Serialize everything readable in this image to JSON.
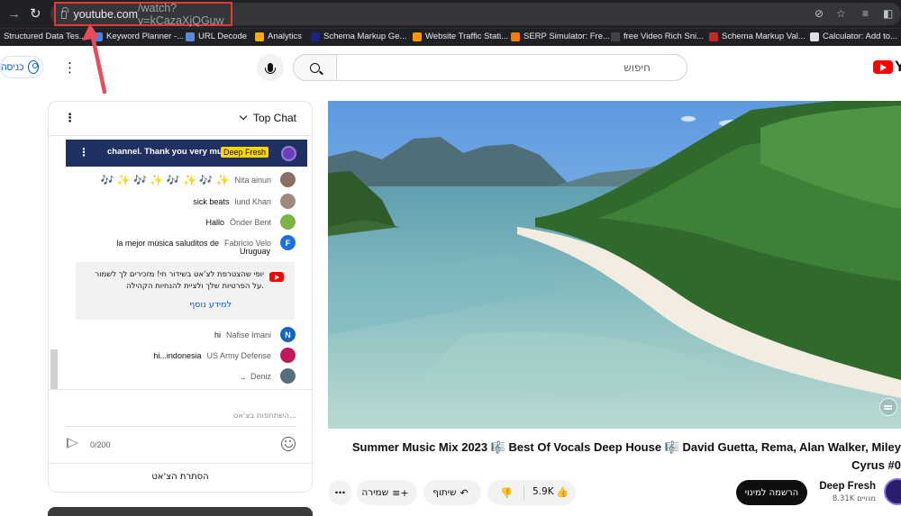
{
  "browser": {
    "url_host": "youtube.com",
    "url_path": "/watch?v=kCazaXjQGuw",
    "bookmarks": [
      {
        "label": "Structured Data Tes...",
        "color": "#9e9e9e"
      },
      {
        "label": "Keyword Planner -...",
        "color": "#4285f4"
      },
      {
        "label": "URL Decode",
        "color": "#5b8bd8"
      },
      {
        "label": "Analytics",
        "color": "#f9ab00"
      },
      {
        "label": "Schema Markup Ge...",
        "color": "#1a237e"
      },
      {
        "label": "Website Traffic Stati...",
        "color": "#ff9800"
      },
      {
        "label": "SERP Simulator: Fre...",
        "color": "#f57c00"
      },
      {
        "label": "free Video Rich Sni...",
        "color": "#424242"
      },
      {
        "label": "Schema Markup Val...",
        "color": "#c62828"
      },
      {
        "label": "Calculator: Add to...",
        "color": "#e0e0e0"
      }
    ]
  },
  "header": {
    "signin_label": "כניסה",
    "search_placeholder": "חיפוש",
    "logo_text": "Y"
  },
  "chat": {
    "title": "Top Chat",
    "pinned": {
      "text": "channel. Thank you very much...",
      "badge": "Deep Fresh"
    },
    "messages": [
      {
        "text": "🎶 ✨ 🎶 ✨ 🎶 ✨ 🎶 ✨",
        "author": "Nita ainun",
        "avatar_color": "#8d6e63",
        "initial": ""
      },
      {
        "text": "sick beats",
        "author": "lund Khan",
        "avatar_color": "#a1887f",
        "initial": ""
      },
      {
        "text": "Hallo",
        "author": "Önder Bent",
        "avatar_color": "#7cb342",
        "initial": ""
      },
      {
        "text": "la mejor música saluditos de",
        "author": "Fabricio Velo",
        "author2": "Uruguay",
        "avatar_color": "#1e6fd9",
        "initial": "F"
      },
      {
        "text": "hi",
        "author": "Nafise Imani",
        "avatar_color": "#1565c0",
        "initial": "N"
      },
      {
        "text": "hi...indonesia",
        "author": "US Army Defense",
        "avatar_color": "#c2185b",
        "initial": ""
      },
      {
        "text": "..",
        "author": "Deniz",
        "avatar_color": "#546e7a",
        "initial": ""
      }
    ],
    "notice_text": "יופי שהצטרפת לצ'אט בשידור חי! מזכירים לך לשמור על הפרטיות שלך ולציית להנחיות הקהילה.",
    "notice_link": "למידע נוסף",
    "compose_placeholder": "השתתפות בצ'אט...",
    "counter": "0/200",
    "hide_label": "הסתרת הצ'אט"
  },
  "video": {
    "title": "Summer Music Mix 2023 🎼 Best Of Vocals Deep House 🎼 David Guetta, Rema, Alan Walker, Miley Cyrus #0",
    "likes": "5.9K",
    "share_label": "שיתוף",
    "save_label": "שמירה",
    "subscribe_label": "הרשמה למינוי",
    "channel_name": "Deep Fresh",
    "subscribers": "8.31K מנויים"
  }
}
